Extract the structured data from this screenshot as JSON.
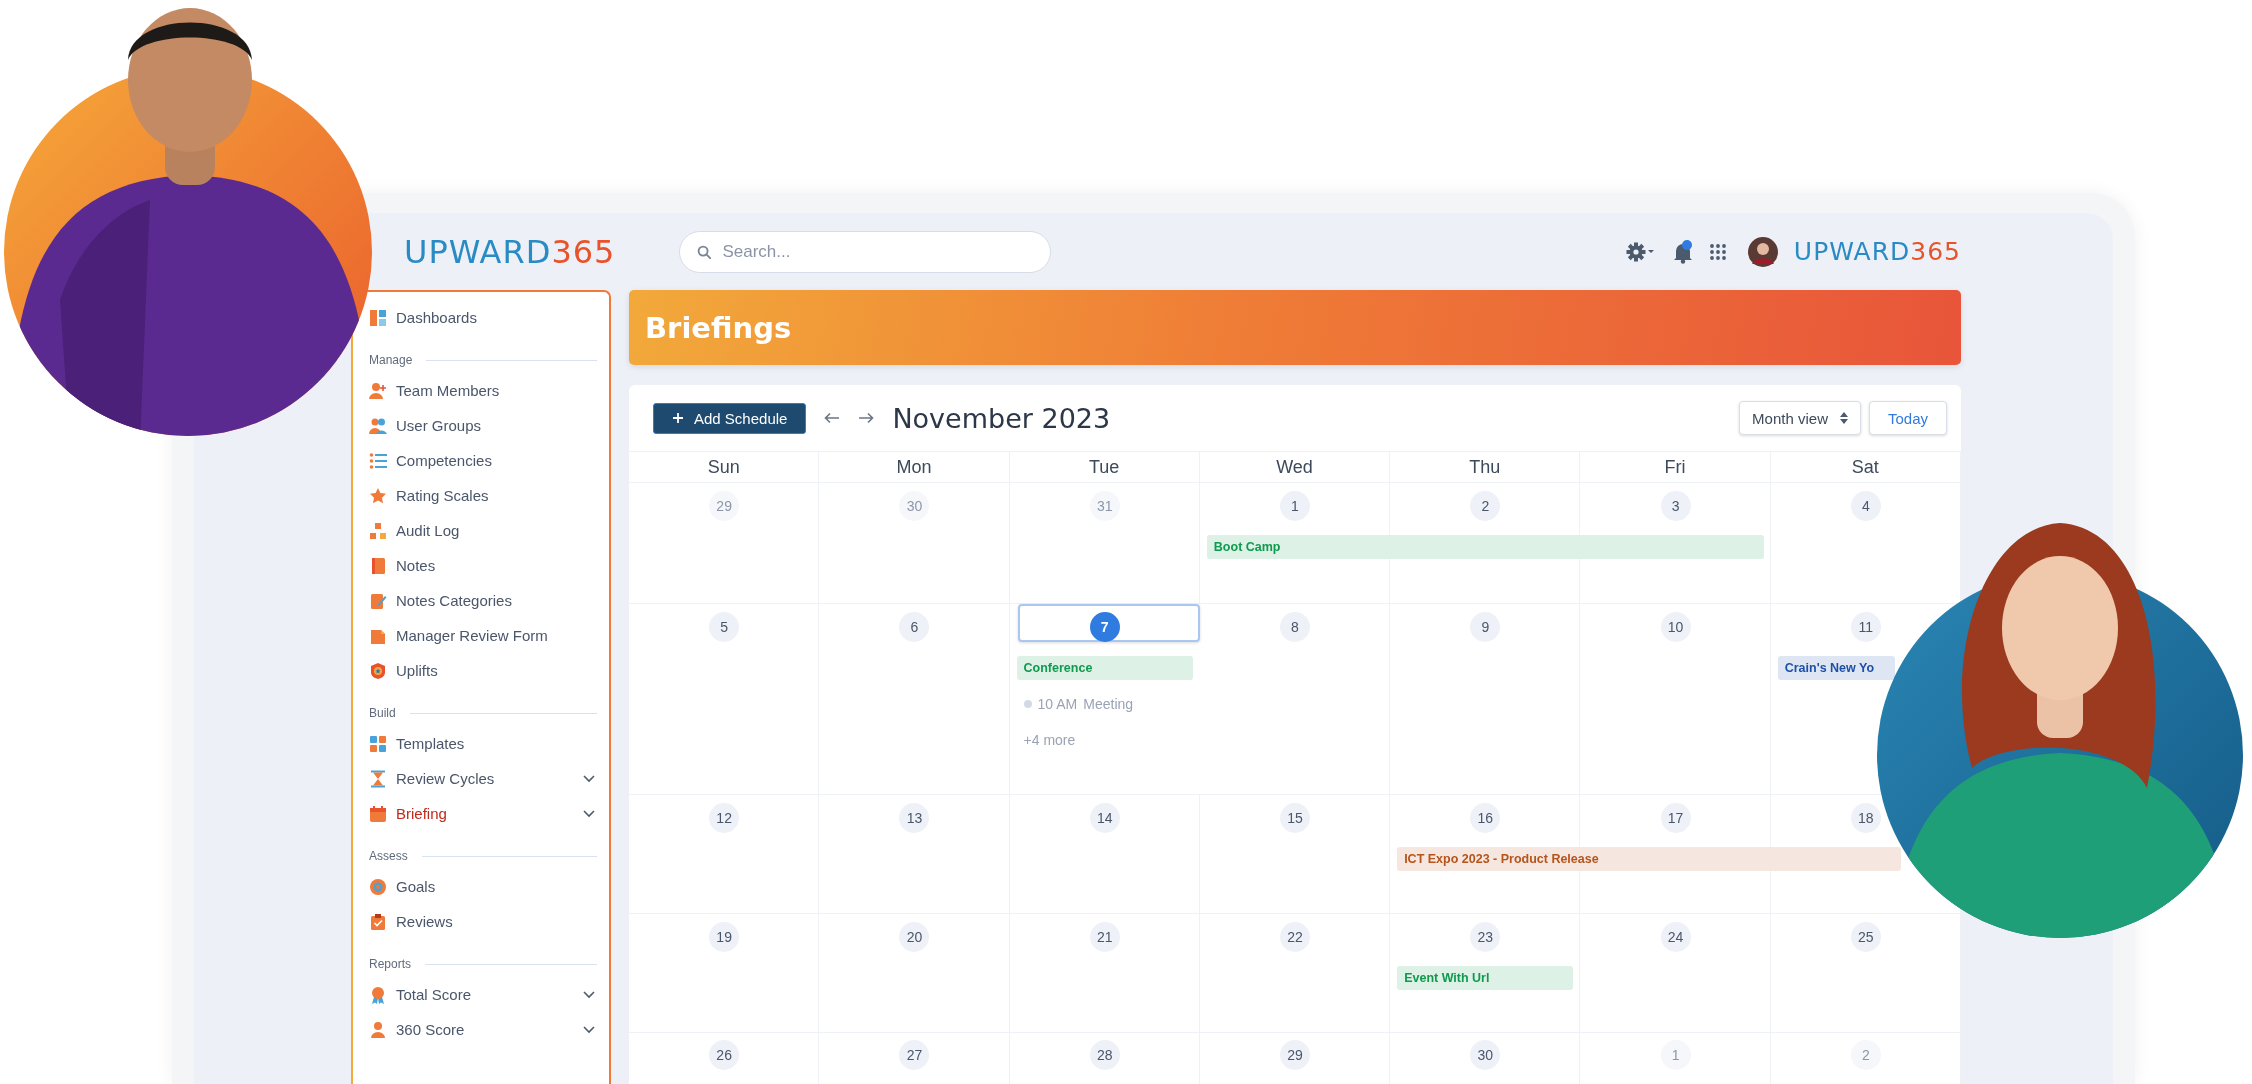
{
  "header": {
    "logo": {
      "word": "UPWARD",
      "number": "365"
    },
    "search": {
      "placeholder": "Search..."
    },
    "brand_logo": {
      "word": "UPWARD",
      "number": "365"
    }
  },
  "sidebar": {
    "top_items": [
      {
        "label": "Dashboards",
        "selected": false,
        "expandable": false
      }
    ],
    "sections": [
      {
        "title": "Manage",
        "items": [
          {
            "label": "Team Members",
            "selected": false,
            "expandable": false
          },
          {
            "label": "User Groups",
            "selected": false,
            "expandable": false
          },
          {
            "label": "Competencies",
            "selected": false,
            "expandable": false
          },
          {
            "label": "Rating Scales",
            "selected": false,
            "expandable": false
          },
          {
            "label": "Audit Log",
            "selected": false,
            "expandable": false
          },
          {
            "label": "Notes",
            "selected": false,
            "expandable": false
          },
          {
            "label": "Notes Categories",
            "selected": false,
            "expandable": false
          },
          {
            "label": "Manager Review Form",
            "selected": false,
            "expandable": false
          },
          {
            "label": "Uplifts",
            "selected": false,
            "expandable": false
          }
        ]
      },
      {
        "title": "Build",
        "items": [
          {
            "label": "Templates",
            "selected": false,
            "expandable": false
          },
          {
            "label": "Review Cycles",
            "selected": false,
            "expandable": true
          },
          {
            "label": "Briefing",
            "selected": true,
            "expandable": true
          }
        ]
      },
      {
        "title": "Assess",
        "items": [
          {
            "label": "Goals",
            "selected": false,
            "expandable": false
          },
          {
            "label": "Reviews",
            "selected": false,
            "expandable": false
          }
        ]
      },
      {
        "title": "Reports",
        "items": [
          {
            "label": "Total Score",
            "selected": false,
            "expandable": true
          },
          {
            "label": "360 Score",
            "selected": false,
            "expandable": true
          }
        ]
      }
    ]
  },
  "page_title": "Briefings",
  "calendar": {
    "add_button": "Add Schedule",
    "month": "November 2023",
    "view_select": "Month view",
    "today_button": "Today",
    "weekdays": [
      "Sun",
      "Mon",
      "Tue",
      "Wed",
      "Thu",
      "Fri",
      "Sat"
    ],
    "weeks": [
      {
        "days": [
          {
            "label": "29",
            "in_month": false,
            "today": false
          },
          {
            "label": "30",
            "in_month": false,
            "today": false
          },
          {
            "label": "31",
            "in_month": false,
            "today": false
          },
          {
            "label": "1",
            "in_month": true,
            "today": false,
            "events": [
              {
                "kind": "bar",
                "title": "Boot Camp",
                "color": "#0f9a4e"
              }
            ]
          },
          {
            "label": "2",
            "in_month": true,
            "today": false
          },
          {
            "label": "3",
            "in_month": true,
            "today": false
          },
          {
            "label": "4",
            "in_month": true,
            "today": false
          }
        ]
      },
      {
        "days": [
          {
            "label": "5",
            "in_month": true,
            "today": false
          },
          {
            "label": "6",
            "in_month": true,
            "today": false
          },
          {
            "label": "7",
            "in_month": true,
            "today": true,
            "events": [
              {
                "kind": "bar",
                "title": "Conference",
                "color": "#0f9a4e"
              },
              {
                "kind": "timed",
                "time": "10 AM",
                "title": "Meeting"
              },
              {
                "kind": "more",
                "title": "+4 more"
              }
            ]
          },
          {
            "label": "8",
            "in_month": true,
            "today": false
          },
          {
            "label": "9",
            "in_month": true,
            "today": false
          },
          {
            "label": "10",
            "in_month": true,
            "today": false
          },
          {
            "label": "11",
            "in_month": true,
            "today": false,
            "events": [
              {
                "kind": "bar",
                "title": "Crain's New Yo",
                "color": "#1d4fa8"
              }
            ]
          }
        ]
      },
      {
        "days": [
          {
            "label": "12",
            "in_month": true,
            "today": false
          },
          {
            "label": "13",
            "in_month": true,
            "today": false
          },
          {
            "label": "14",
            "in_month": true,
            "today": false
          },
          {
            "label": "15",
            "in_month": true,
            "today": false
          },
          {
            "label": "16",
            "in_month": true,
            "today": false,
            "events": [
              {
                "kind": "bar",
                "title": "ICT Expo 2023 - Product Release",
                "color": "#b5541c"
              }
            ]
          },
          {
            "label": "17",
            "in_month": true,
            "today": false
          },
          {
            "label": "18",
            "in_month": true,
            "today": false
          }
        ]
      },
      {
        "days": [
          {
            "label": "19",
            "in_month": true,
            "today": false
          },
          {
            "label": "20",
            "in_month": true,
            "today": false
          },
          {
            "label": "21",
            "in_month": true,
            "today": false
          },
          {
            "label": "22",
            "in_month": true,
            "today": false
          },
          {
            "label": "23",
            "in_month": true,
            "today": false,
            "events": [
              {
                "kind": "bar",
                "title": "Event With Url",
                "color": "#0f9a4e"
              }
            ]
          },
          {
            "label": "24",
            "in_month": true,
            "today": false
          },
          {
            "label": "25",
            "in_month": true,
            "today": false
          }
        ]
      },
      {
        "days": [
          {
            "label": "26",
            "in_month": true,
            "today": false
          },
          {
            "label": "27",
            "in_month": true,
            "today": false
          },
          {
            "label": "28",
            "in_month": true,
            "today": false
          },
          {
            "label": "29",
            "in_month": true,
            "today": false
          },
          {
            "label": "30",
            "in_month": true,
            "today": false
          },
          {
            "label": "1",
            "in_month": false,
            "today": false
          },
          {
            "label": "2",
            "in_month": false,
            "today": false
          }
        ]
      }
    ]
  }
}
